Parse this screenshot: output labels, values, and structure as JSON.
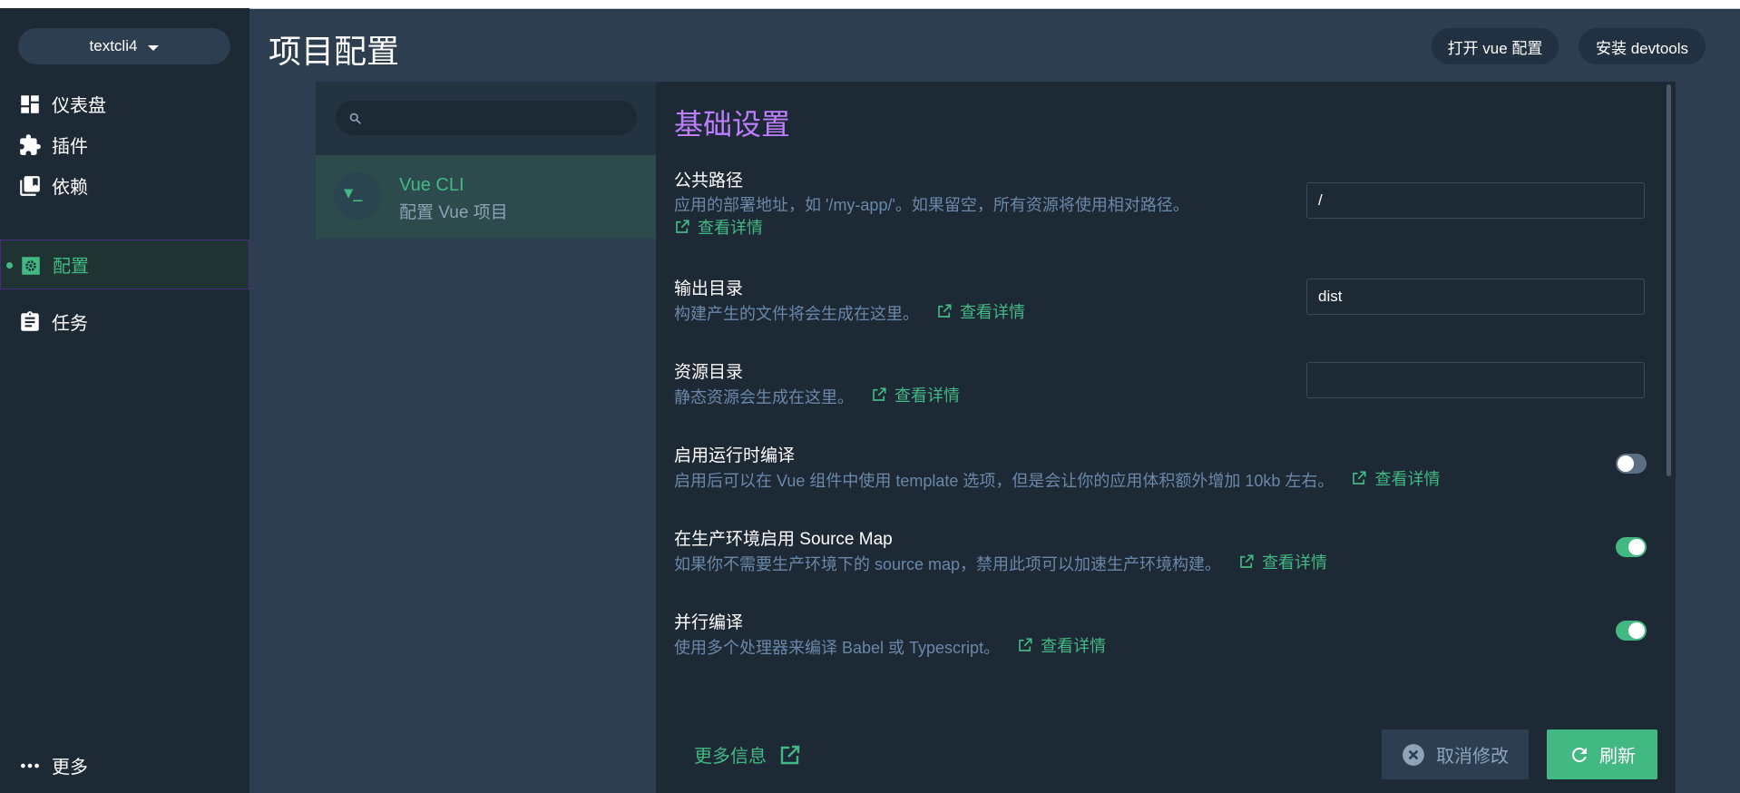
{
  "project": {
    "name": "textcli4"
  },
  "sidebar": {
    "items": [
      {
        "label": "仪表盘",
        "icon": "dashboard-icon"
      },
      {
        "label": "插件",
        "icon": "puzzle-icon"
      },
      {
        "label": "依赖",
        "icon": "library-icon"
      },
      {
        "label": "配置",
        "icon": "settings-icon",
        "active": true
      },
      {
        "label": "任务",
        "icon": "clipboard-icon"
      }
    ],
    "more_label": "更多"
  },
  "header": {
    "title": "项目配置",
    "open_vue_config": "打开 vue 配置",
    "install_devtools": "安装 devtools"
  },
  "search": {
    "value": "",
    "placeholder": ""
  },
  "config_list": [
    {
      "name": "Vue CLI",
      "description": "配置 Vue 项目",
      "icon_text": "▼_"
    }
  ],
  "main": {
    "section_title": "基础设置",
    "link_label": "查看详情",
    "settings": [
      {
        "title": "公共路径",
        "description": "应用的部署地址，如 '/my-app/'。如果留空，所有资源将使用相对路径。",
        "type": "input",
        "value": "/"
      },
      {
        "title": "输出目录",
        "description": "构建产生的文件将会生成在这里。",
        "type": "input",
        "value": "dist"
      },
      {
        "title": "资源目录",
        "description": "静态资源会生成在这里。",
        "type": "input",
        "value": ""
      },
      {
        "title": "启用运行时编译",
        "description": "启用后可以在 Vue 组件中使用 template 选项，但是会让你的应用体积额外增加 10kb 左右。",
        "type": "toggle",
        "checked": false
      },
      {
        "title": "在生产环境启用 Source Map",
        "description": "如果你不需要生产环境下的 source map，禁用此项可以加速生产环境构建。",
        "type": "toggle",
        "checked": true
      },
      {
        "title": "并行编译",
        "description": "使用多个处理器来编译 Babel 或 Typescript。",
        "type": "toggle",
        "checked": true
      }
    ],
    "more_info": "更多信息",
    "cancel_label": "取消修改",
    "refresh_label": "刷新"
  },
  "colors": {
    "accent": "#42b983",
    "section_title": "#bd7eff",
    "background": "#2c3e50",
    "sidebar": "#1d2935"
  }
}
